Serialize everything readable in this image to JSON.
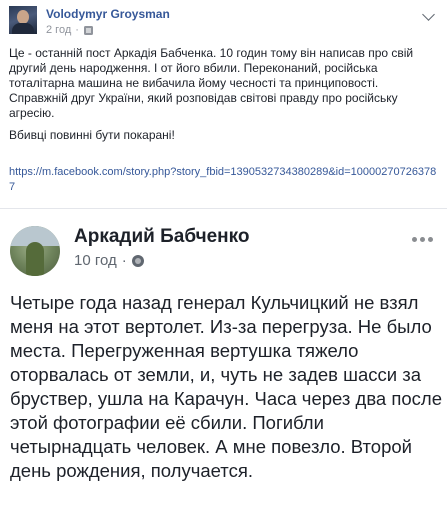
{
  "post": {
    "author": "Volodymyr Groysman",
    "time": "2 год",
    "paragraph1": "Це - останній пост Аркадія Бабченка. 10 годин тому він написав про свій другий день народження. І от його вбили. Переконаний, російська тоталітарна машина не вибачила йому чесності та принциповості. Справжній друг України, який розповідав світові правду про російську агресію.",
    "paragraph2": "Вбивці повинні бути покарані!",
    "link": "https://m.facebook.com/story.php?story_fbid=1390532734380289&id=100002707263787"
  },
  "shared": {
    "author": "Аркадий Бабченко",
    "time": "10 год",
    "text": "Четыре года назад генерал Кульчицкий не взял меня на этот вертолет. Из-за перегруза. Не было места. Перегруженная вертушка тяжело оторвалась от земли, и, чуть не задев шасси за бруствер, ушла на Карачун. Часа через два после этой фотографии её сбили. Погибли четырнадцать человек. А мне повезло. Второй день рождения, получается."
  },
  "colors": {
    "link": "#365899",
    "text": "#1d2129",
    "meta": "#90949c"
  },
  "icons": [
    "avatar",
    "privacy-icon",
    "chevron-down-icon",
    "globe-icon",
    "more-icon"
  ]
}
